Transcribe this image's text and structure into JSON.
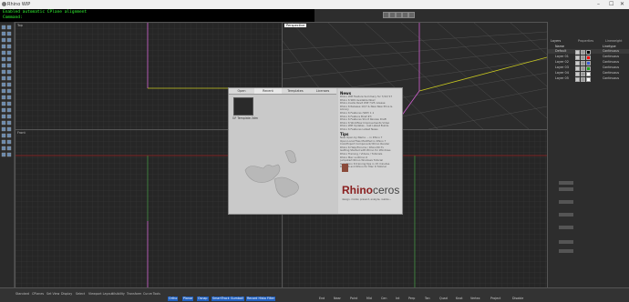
{
  "window": {
    "title": "Rhino WIP",
    "minimize": "–",
    "maximize": "☐",
    "close": "✕"
  },
  "command": {
    "line1": "Enabled automatic CPlane alignment",
    "line2": "Command:"
  },
  "viewports": [
    {
      "title": "Top",
      "active": false
    },
    {
      "title": "Perspective",
      "active": true
    },
    {
      "title": "Front",
      "active": false
    },
    {
      "title": "Right",
      "active": false
    }
  ],
  "layers_panel": {
    "tabs": [
      "Layers",
      "Properties",
      "Lineweight"
    ],
    "headers": [
      "Name",
      "",
      "",
      "",
      "Linetype"
    ],
    "rows": [
      {
        "name": "Default",
        "linetype": "Continuous",
        "color": "#000000"
      },
      {
        "name": "Layer 01",
        "linetype": "Continuous",
        "color": "#ff0000"
      },
      {
        "name": "Layer 02",
        "linetype": "Continuous",
        "color": "#3a60d8"
      },
      {
        "name": "Layer 03",
        "linetype": "Continuous",
        "color": "#1fa31f"
      },
      {
        "name": "Layer 04",
        "linetype": "Continuous",
        "color": "#ffffff"
      },
      {
        "name": "Layer 05",
        "linetype": "Continuous",
        "color": "#ffffff"
      }
    ]
  },
  "splash": {
    "tabs": [
      "Open",
      "Recent",
      "Templates",
      "Licenses"
    ],
    "recent_file": "GF Template.3dm",
    "news_heading": "News",
    "news_items": [
      "Rhino WIP Feature Summary for 7/22/'17",
      "Rhino 6 SR9 Available Now!",
      "Rhino.Inside Revit WIP 7/25 release",
      "Rhino 6 Release 10/7 & New New Price & Library",
      "Rhino 6 Features (WIP) 1.1",
      "Rhino 6 Feature Brief #3",
      "Rhino 6 Features Short Review Draft",
      "Rhino 6 Workflow Improvements Video",
      "Rhino WIP Updates - Get Latest Builds",
      "Rhino 6 Features Latest News"
    ],
    "tips_heading": "Tips",
    "tips_items": [
      "New Open by Name ... in Rhino 7",
      "Open Local Files Modified in Rhino 7",
      "ColorExport Component/ Rhino Render",
      "Rhino 6 Help/Forums / Rhino3D.Tv",
      "Getting Started with Rhino for Windows",
      "Rhino Training / Videos / Tutorials",
      "Rhino Mac vs Rhino 6",
      "Jumpstart Rhino Windows Tutorial",
      "Get Rhino 6 training tips in 15 minutes",
      "Rhino 6 and Rhino for Mac 6 Tutorial"
    ],
    "brand": "Rhino",
    "brand_suffix": "ceros",
    "tagline": "design, model, present, analyze, realize..."
  },
  "status_tabs": [
    "Standard",
    "CPlanes",
    "Set View",
    "Display",
    "Select",
    "Viewport Layout",
    "Visibility",
    "Transform",
    "Curve Tools",
    "Surface Tools",
    "Solid Tools",
    "Mesh Tools",
    "Render Tools",
    "Drafting",
    "New in V6"
  ],
  "osnaps": [
    "End",
    "Near",
    "Point",
    "Mid",
    "Cen",
    "Int",
    "Perp",
    "Tan",
    "Quad",
    "Knot",
    "Vertex",
    "Project",
    "Disable"
  ],
  "status_fields": [
    "Ortho",
    "Planar",
    "Osnap",
    "SmartTrack",
    "Gumball",
    "Record History",
    "Filter"
  ]
}
